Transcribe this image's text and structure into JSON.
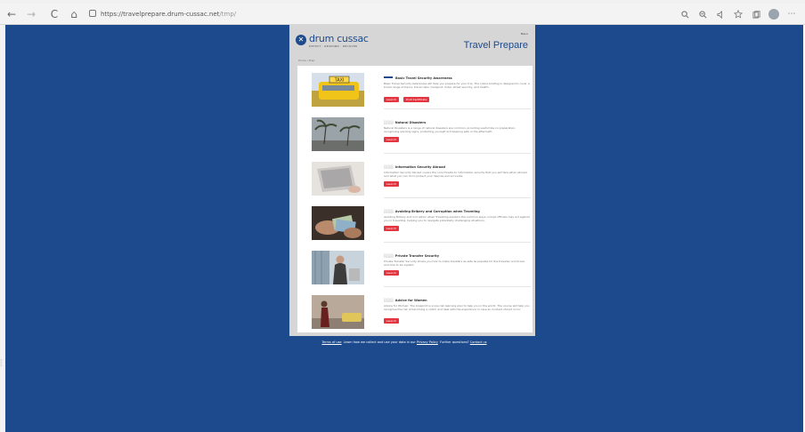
{
  "browser": {
    "url_host": "https://travelprepare.drum-cussac.net",
    "url_path": "/tmp/",
    "back_glyph": "←",
    "forward_glyph": "→",
    "reload_glyph": "C",
    "home_glyph": "⌂",
    "right_icons": [
      "search-icon",
      "zoom-icon",
      "read-aloud-icon",
      "favorite-icon",
      "collections-icon",
      "profile-icon",
      "more-icon"
    ]
  },
  "site": {
    "logo_text": "drum cussac",
    "logo_sub": "DETECT · RESPOND · RECOVER",
    "header_small": "Menu",
    "header_title": "Travel Prepare",
    "breadcrumb": "Home / Prep"
  },
  "cards": [
    {
      "tag": "Basic Travel Security Awareness",
      "desc": "Basic Travel Security Awareness will help you prepare for your trip. The online briefing is designed to cover a broad range of topics, travel risks, transport, hotel, street security, and health.",
      "buttons": [
        "Launch",
        "Print Certificate"
      ]
    },
    {
      "tag": "Natural Disasters",
      "desc": "Natural Disasters is a range of natural disasters are common, providing useful tips on preparation, recognising warning signs, protecting yourself and keeping safe in the aftermath.",
      "buttons": [
        "Launch"
      ]
    },
    {
      "tag": "Information Security Abroad",
      "desc": "Information Security Abroad covers the core threats to information security that you will face when abroad, and what you can do to protect your devices and accounts.",
      "buttons": [
        "Launch"
      ]
    },
    {
      "tag": "Avoiding Bribery and Corruption when Traveling",
      "desc": "Avoiding Bribery and Corruption when Travelling explains the common ways corrupt officials may act against you in travelling, helping you to navigate potentially challenging situations.",
      "buttons": [
        "Launch"
      ]
    },
    {
      "tag": "Private Transfer Security",
      "desc": "Private Transfer Security shows you how to make transfers as safe as possible for the traveller and driver, and how to be vigilant.",
      "buttons": [
        "Launch"
      ]
    },
    {
      "tag": "Advice for Women",
      "desc": "Advice for Women: The blueprint is a low-risk learning plan to help you in the world. The course will help you recognise the risk of becoming a victim and deal with the experience in case an incident should occur.",
      "buttons": [
        "Launch"
      ]
    }
  ],
  "footer": {
    "terms": "Terms of use",
    "middle": "Learn how we collect and use your data in our",
    "privacy": "Privacy Policy",
    "questions": "Further questions?",
    "contact": "Contact us"
  },
  "colors": {
    "brand_blue": "#1d4a8c",
    "button_red": "#e53540"
  }
}
